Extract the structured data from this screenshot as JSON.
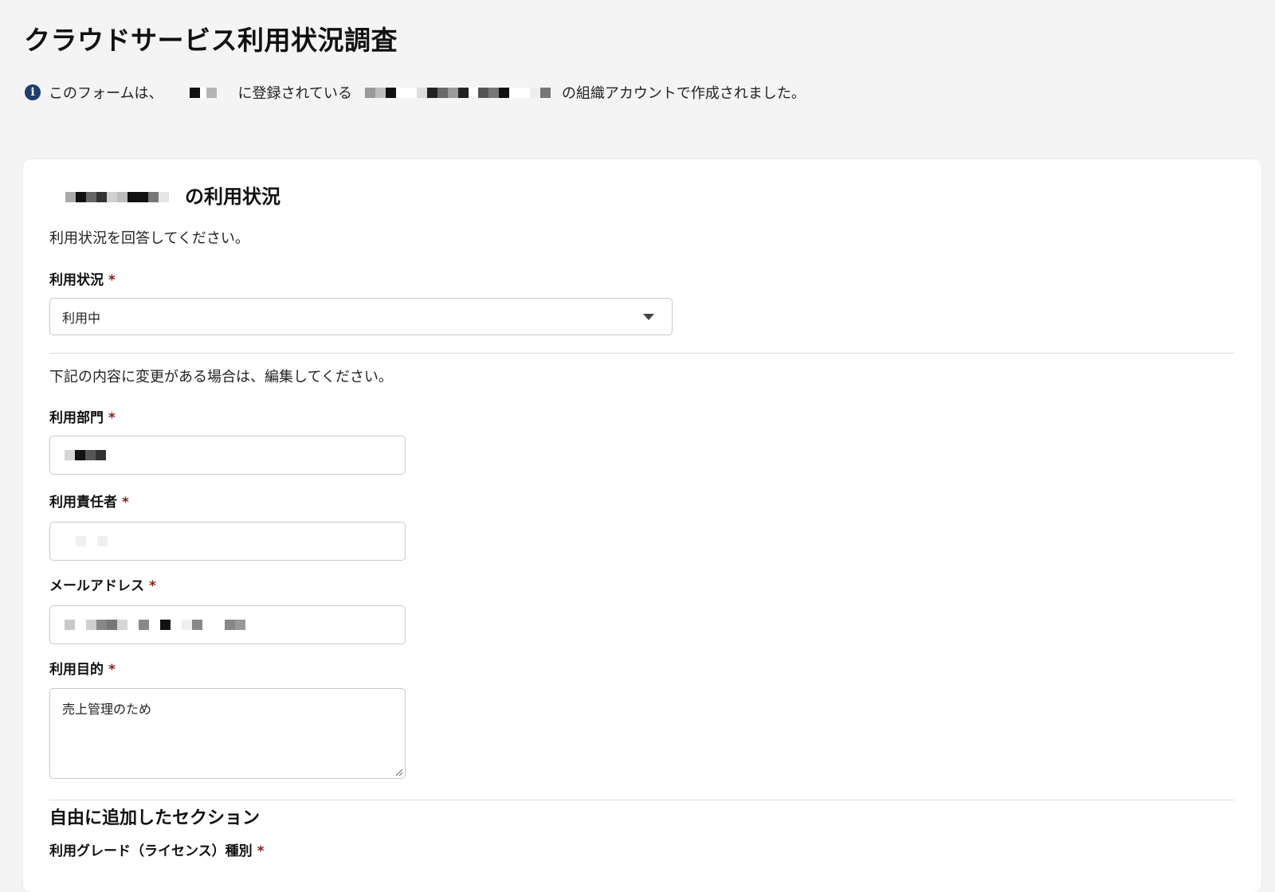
{
  "page": {
    "title": "クラウドサービス利用状況調査"
  },
  "notice": {
    "prefix": "このフォームは、",
    "middle": "に登録されている",
    "suffix": "の組織アカウントで作成されました。"
  },
  "section": {
    "title_suffix": "の利用状況",
    "description": "利用状況を回答してください。"
  },
  "usage_status": {
    "label": "利用状況",
    "required_mark": "*",
    "value": "利用中"
  },
  "edit_note": "下記の内容に変更がある場合は、編集してください。",
  "fields": {
    "department": {
      "label": "利用部門",
      "required_mark": "*"
    },
    "owner": {
      "label": "利用責任者",
      "required_mark": "*"
    },
    "email": {
      "label": "メールアドレス",
      "required_mark": "*"
    },
    "purpose": {
      "label": "利用目的",
      "required_mark": "*",
      "value": "売上管理のため"
    }
  },
  "custom_section": {
    "title": "自由に追加したセクション",
    "grade_label": "利用グレード（ライセンス）種別",
    "required_mark": "*"
  },
  "colors": {
    "background": "#f4f4f4",
    "card": "#ffffff",
    "info_icon": "#1f3e6e",
    "required": "#8b1a1a",
    "border": "#c9c9c9"
  },
  "icons": {
    "info": "info-circle-icon",
    "dropdown": "chevron-down-icon",
    "resize": "resize-grip-icon"
  }
}
